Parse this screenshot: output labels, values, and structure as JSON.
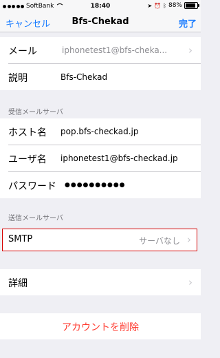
{
  "status_bar": {
    "carrier": "SoftBank",
    "time": "18:40",
    "battery": "88%",
    "battery_level": 0.88
  },
  "nav": {
    "cancel": "キャンセル",
    "title": "Bfs-Chekad",
    "done": "完了"
  },
  "account": {
    "mail_label": "メール",
    "mail_value": "iphonetest1@bfs-cheka...",
    "desc_label": "説明",
    "desc_value": "Bfs-Chekad"
  },
  "incoming": {
    "header": "受信メールサーバ",
    "host_label": "ホスト名",
    "host_value": "pop.bfs-checkad.jp",
    "user_label": "ユーザ名",
    "user_value": "iphonetest1@bfs-checkad.jp",
    "pass_label": "パスワード",
    "pass_value": "●●●●●●●●●●"
  },
  "outgoing": {
    "header": "送信メールサーバ",
    "smtp_label": "SMTP",
    "smtp_value": "サーバなし"
  },
  "advanced": {
    "label": "詳細"
  },
  "delete_label": "アカウントを削除",
  "colors": {
    "accent": "#1a7cff",
    "destructive": "#ff3b30",
    "highlight": "#d50000"
  }
}
